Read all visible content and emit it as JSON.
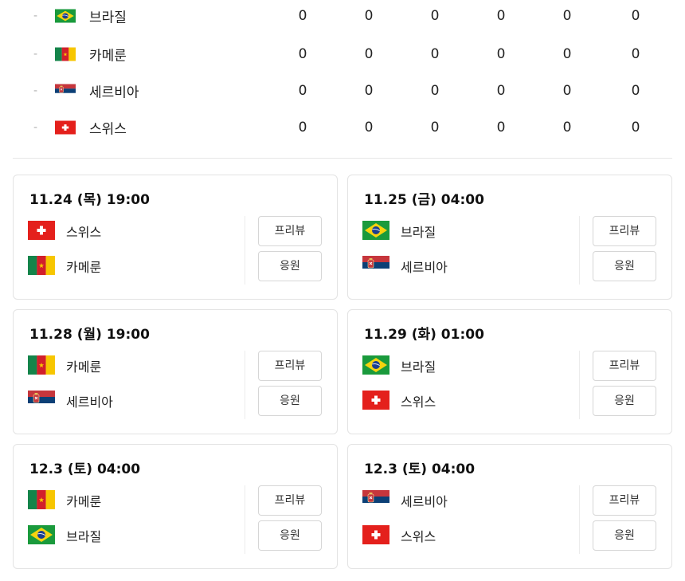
{
  "standings": {
    "rows": [
      {
        "rank": "-",
        "team": "브라질",
        "flag": "brazil-flag-icon",
        "stats": [
          "0",
          "0",
          "0",
          "0",
          "0",
          "0"
        ]
      },
      {
        "rank": "-",
        "team": "카메룬",
        "flag": "cameroon-flag-icon",
        "stats": [
          "0",
          "0",
          "0",
          "0",
          "0",
          "0"
        ]
      },
      {
        "rank": "-",
        "team": "세르비아",
        "flag": "serbia-flag-icon",
        "stats": [
          "0",
          "0",
          "0",
          "0",
          "0",
          "0"
        ]
      },
      {
        "rank": "-",
        "team": "스위스",
        "flag": "switzerland-flag-icon",
        "stats": [
          "0",
          "0",
          "0",
          "0",
          "0",
          "0"
        ]
      }
    ]
  },
  "matches": [
    {
      "date": "11.24 (목) 19:00",
      "team1": "스위스",
      "team2": "카메룬",
      "preview_label": "프리뷰",
      "cheer_label": "응원"
    },
    {
      "date": "11.25 (금) 04:00",
      "team1": "브라질",
      "team2": "세르비아",
      "preview_label": "프리뷰",
      "cheer_label": "응원"
    },
    {
      "date": "11.28 (월) 19:00",
      "team1": "카메룬",
      "team2": "세르비아",
      "preview_label": "프리뷰",
      "cheer_label": "응원"
    },
    {
      "date": "11.29 (화) 01:00",
      "team1": "브라질",
      "team2": "스위스",
      "preview_label": "프리뷰",
      "cheer_label": "응원"
    },
    {
      "date": "12.3 (토) 04:00",
      "team1": "카메룬",
      "team2": "브라질",
      "preview_label": "프리뷰",
      "cheer_label": "응원"
    },
    {
      "date": "12.3 (토) 04:00",
      "team1": "세르비아",
      "team2": "스위스",
      "preview_label": "프리뷰",
      "cheer_label": "응원"
    }
  ],
  "colors": {
    "brazil_green": "#1a9a3c",
    "brazil_yellow": "#f6d30f",
    "brazil_blue": "#1b3f8f",
    "cameroon_green": "#14844a",
    "cameroon_red": "#d21f2b",
    "cameroon_yellow": "#f7c600",
    "serbia_red": "#c6363c",
    "serbia_blue": "#0c4076",
    "swiss_red": "#e4201c"
  }
}
